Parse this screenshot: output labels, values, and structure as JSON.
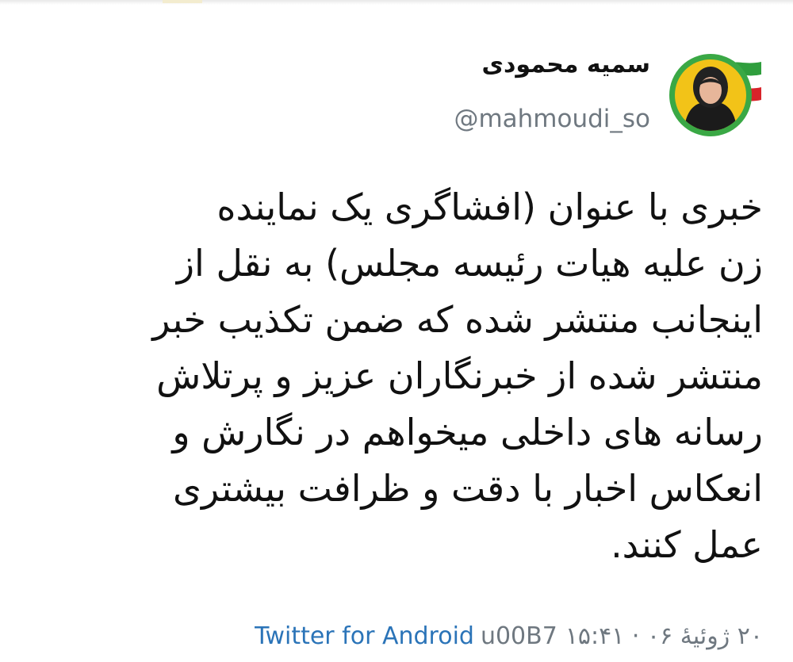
{
  "author": {
    "display_name": "سمیه محمودی",
    "handle": "@mahmoudi_so",
    "avatar_icon": "profile-photo-with-iran-flag"
  },
  "tweet": {
    "lines": [
      "خبری با عنوان (افشاگری یک نماینده",
      "زن علیه هیات رئیسه مجلس) به نقل از",
      "اینجانب منتشر شده که ضمن تکذیب خبر",
      "منتشر شده از خبرنگاران عزیز و پرتلاش",
      "رسانه های داخلی میخواهم در نگارش و",
      "انعکاس اخبار با دقت و ظرافت بیشتری",
      "عمل کنند."
    ]
  },
  "footer": {
    "source": "Twitter for Android",
    "separator": "u00B7",
    "datetime": "۲۰ ژوئیهٔ ۰۶ · ۱۵:۴۱"
  },
  "colors": {
    "link": "#2b74b8",
    "muted": "#6f7880",
    "text": "#111111",
    "avatar_ring": "#3aa845",
    "avatar_bg": "#f2c318"
  }
}
